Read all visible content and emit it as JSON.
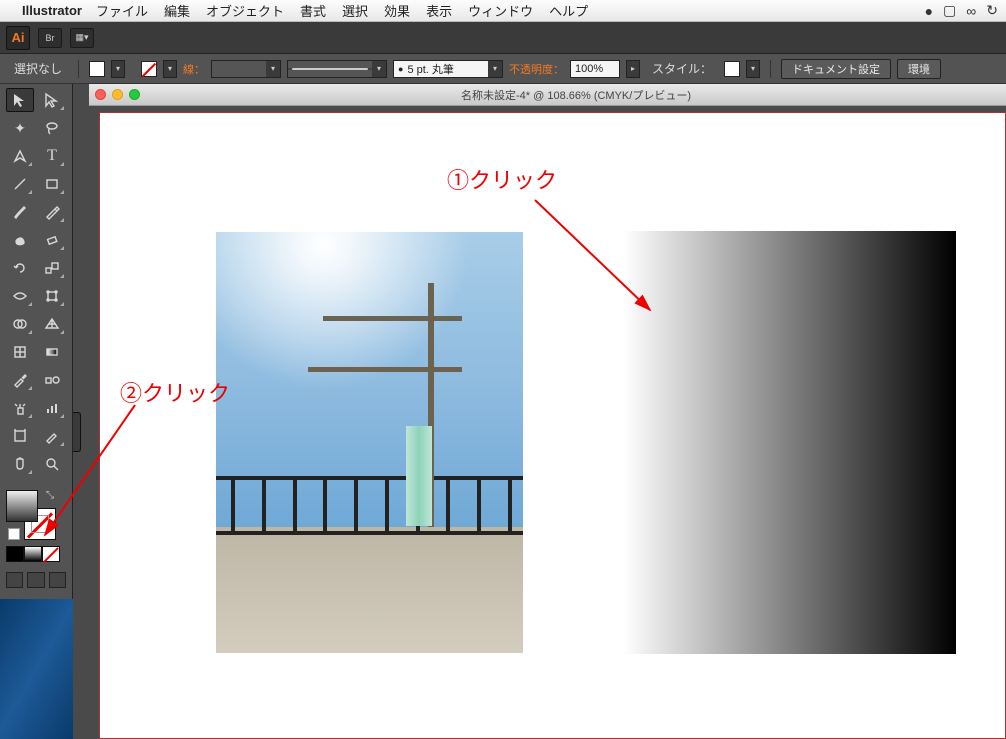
{
  "menubar": {
    "app": "Illustrator",
    "items": [
      "ファイル",
      "編集",
      "オブジェクト",
      "書式",
      "選択",
      "効果",
      "表示",
      "ウィンドウ",
      "ヘルプ"
    ]
  },
  "controlbar": {
    "selection": "選択なし",
    "stroke_label": "線：",
    "brush_label": "5 pt. 丸筆",
    "opacity_label": "不透明度：",
    "opacity_value": "100%",
    "style_label": "スタイル：",
    "doc_setup": "ドキュメント設定",
    "prefs": "環境"
  },
  "document": {
    "title": "名称未設定-4* @ 108.66% (CMYK/プレビュー)"
  },
  "annotations": {
    "a1": "①クリック",
    "a2": "②クリック"
  },
  "tools": {
    "names": [
      "selection-tool",
      "direct-selection-tool",
      "magic-wand-tool",
      "lasso-tool",
      "pen-tool",
      "type-tool",
      "line-tool",
      "rectangle-tool",
      "paintbrush-tool",
      "pencil-tool",
      "blob-brush-tool",
      "eraser-tool",
      "rotate-tool",
      "scale-tool",
      "width-tool",
      "free-transform-tool",
      "shape-builder-tool",
      "perspective-tool",
      "mesh-tool",
      "gradient-tool",
      "eyedropper-tool",
      "blend-tool",
      "symbol-sprayer-tool",
      "graph-tool",
      "artboard-tool",
      "slice-tool",
      "hand-tool",
      "zoom-tool"
    ]
  }
}
